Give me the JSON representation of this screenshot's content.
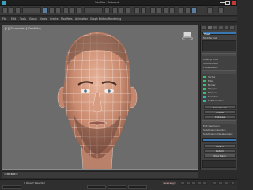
{
  "window": {
    "title": "3ds Max - Autodesk",
    "accent": "#3aa0b8"
  },
  "menubar": {
    "items": [
      "File",
      "Edit",
      "Tools",
      "Group",
      "Views",
      "Create",
      "Modifiers",
      "Animation",
      "Graph Editors",
      "Rendering"
    ]
  },
  "viewport": {
    "label": "[+] [Perspective] [Realistic]"
  },
  "right_panel": {
    "tabs": [
      "create",
      "modify",
      "hierarchy",
      "motion",
      "display",
      "utilities"
    ],
    "object_name": "Head",
    "modifier_list_label": "Modifier List",
    "rows": [
      "Unwrap UVW",
      "TurboSmooth",
      "Editable Poly",
      "Vertex",
      "Edge",
      "Border",
      "Polygon",
      "Element",
      "Selection",
      "Soft Selection",
      "Edit Geometry",
      "Subdivision Surface",
      "Subdivision Displacement"
    ],
    "buttons": [
      "Repeat Last",
      "Create",
      "Collapse",
      "Attach",
      "Detach",
      "Slice Plane"
    ]
  },
  "timeline": {
    "slider_label": "0 / 100"
  },
  "statusbar": {
    "status_text": "1 Object Selected",
    "key_label": "Auto Key"
  }
}
